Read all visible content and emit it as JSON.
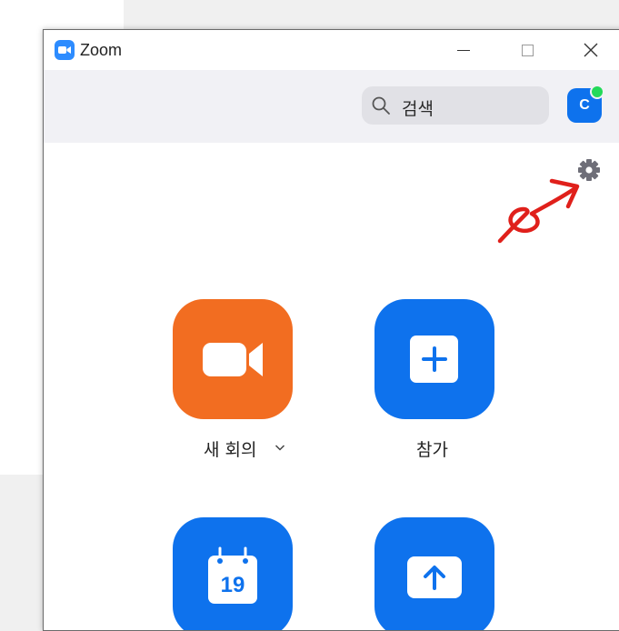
{
  "window": {
    "title": "Zoom"
  },
  "header": {
    "search_placeholder": "검색",
    "avatar_initial": "C"
  },
  "actions": [
    {
      "label": "새 회의",
      "icon": "video-camera-icon",
      "color": "#f26d21",
      "has_dropdown": true
    },
    {
      "label": "참가",
      "icon": "plus-icon",
      "color": "#0e72ed",
      "has_dropdown": false
    },
    {
      "label": "",
      "icon": "calendar-icon",
      "color": "#0e72ed",
      "calendar_day": "19"
    },
    {
      "label": "",
      "icon": "share-screen-icon",
      "color": "#0e72ed"
    }
  ],
  "colors": {
    "brand_blue": "#2D8CFF",
    "action_blue": "#0e72ed",
    "new_meeting_orange": "#f26d21",
    "status_online": "#23d959",
    "annotation_red": "#e0201b"
  }
}
